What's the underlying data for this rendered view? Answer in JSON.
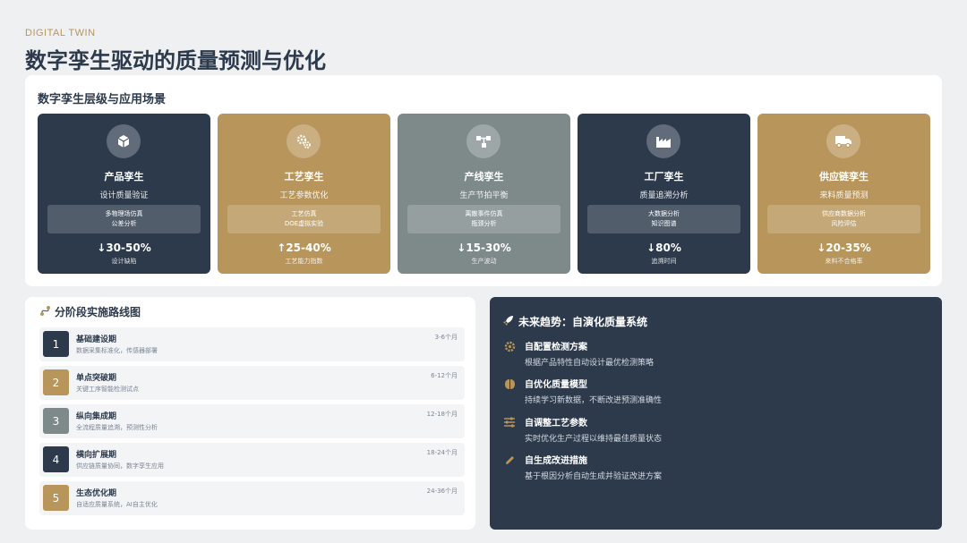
{
  "header": {
    "eyebrow": "DIGITAL TWIN",
    "title": "数字孪生驱动的质量预测与优化"
  },
  "levels": {
    "title": "数字孪生层级与应用场景",
    "cards": [
      {
        "title": "产品孪生",
        "subtitle": "设计质量验证",
        "line1": "多物理场仿真",
        "line2": "公差分析",
        "metric": "↓30-50%",
        "metric_label": "设计缺陷",
        "color": "#2c3a4c",
        "icon": "cube-icon"
      },
      {
        "title": "工艺孪生",
        "subtitle": "工艺参数优化",
        "line1": "工艺仿真",
        "line2": "DOE虚拟实验",
        "metric": "↑25-40%",
        "metric_label": "工艺能力指数",
        "color": "#b8955a",
        "icon": "gears-icon"
      },
      {
        "title": "产线孪生",
        "subtitle": "生产节拍平衡",
        "line1": "离散事件仿真",
        "line2": "瓶颈分析",
        "metric": "↓15-30%",
        "metric_label": "生产波动",
        "color": "#7e8a8a",
        "icon": "network-icon"
      },
      {
        "title": "工厂孪生",
        "subtitle": "质量追溯分析",
        "line1": "大数据分析",
        "line2": "知识图谱",
        "metric": "↓80%",
        "metric_label": "追溯时间",
        "color": "#2c3a4c",
        "icon": "factory-icon"
      },
      {
        "title": "供应链孪生",
        "subtitle": "来料质量预测",
        "line1": "供应商数据分析",
        "line2": "风险评估",
        "metric": "↓20-35%",
        "metric_label": "来料不合格率",
        "color": "#b8955a",
        "icon": "truck-icon"
      }
    ]
  },
  "roadmap": {
    "title": "分阶段实施路线图",
    "items": [
      {
        "num": "1",
        "name": "基础建设期",
        "desc": "数据采集标准化，传感器部署",
        "duration": "3-6个月",
        "color": "#2c3a4c"
      },
      {
        "num": "2",
        "name": "单点突破期",
        "desc": "关键工序智能检测试点",
        "duration": "6-12个月",
        "color": "#b8955a"
      },
      {
        "num": "3",
        "name": "纵向集成期",
        "desc": "全流程质量追溯，预测性分析",
        "duration": "12-18个月",
        "color": "#7e8a8a"
      },
      {
        "num": "4",
        "name": "横向扩展期",
        "desc": "供应链质量协同，数字孪生应用",
        "duration": "18-24个月",
        "color": "#2c3a4c"
      },
      {
        "num": "5",
        "name": "生态优化期",
        "desc": "自适应质量系统，AI自主优化",
        "duration": "24-36个月",
        "color": "#b8955a"
      }
    ]
  },
  "future": {
    "title": "未来趋势：自演化质量系统",
    "items": [
      {
        "title": "自配置检测方案",
        "desc": "根据产品特性自动设计最优检测策略",
        "icon": "gear-icon"
      },
      {
        "title": "自优化质量模型",
        "desc": "持续学习新数据，不断改进预测准确性",
        "icon": "brain-icon"
      },
      {
        "title": "自调整工艺参数",
        "desc": "实时优化生产过程以维持最佳质量状态",
        "icon": "sliders-icon"
      },
      {
        "title": "自生成改进措施",
        "desc": "基于根因分析自动生成并验证改进方案",
        "icon": "pencil-icon"
      }
    ]
  }
}
